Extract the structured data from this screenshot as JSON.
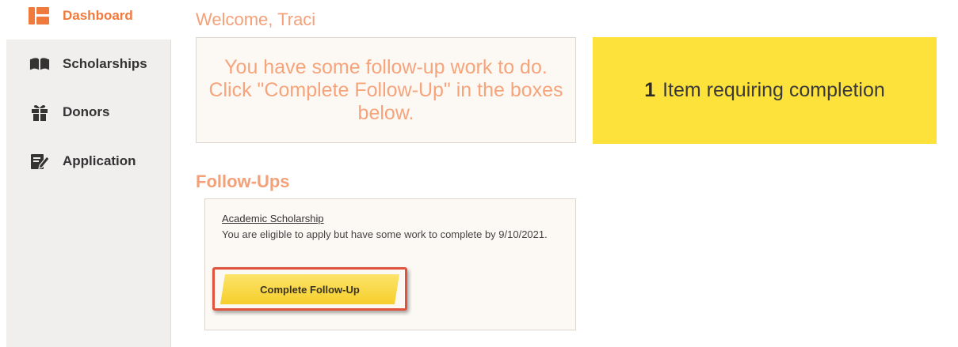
{
  "sidebar": {
    "items": [
      {
        "label": "Dashboard",
        "icon": "dashboard-icon",
        "active": true
      },
      {
        "label": "Scholarships",
        "icon": "book-icon",
        "active": false
      },
      {
        "label": "Donors",
        "icon": "gift-icon",
        "active": false
      },
      {
        "label": "Application",
        "icon": "edit-icon",
        "active": false
      }
    ]
  },
  "main": {
    "welcome": "Welcome, Traci",
    "notice": "You have some follow-up work to do. Click \"Complete Follow-Up\" in the boxes below.",
    "completion": {
      "count": "1",
      "label": "Item requiring completion"
    },
    "followups_title": "Follow-Ups",
    "followups": [
      {
        "name": "Academic Scholarship",
        "description": "You are eligible to apply but have some work to complete by 9/10/2021.",
        "button": "Complete Follow-Up"
      }
    ]
  },
  "colors": {
    "accent": "#f07a3c",
    "heading": "#f4a078",
    "highlight": "#fde23b",
    "sidebar_bg": "#f1eeee",
    "button_outline": "#e0533d"
  }
}
